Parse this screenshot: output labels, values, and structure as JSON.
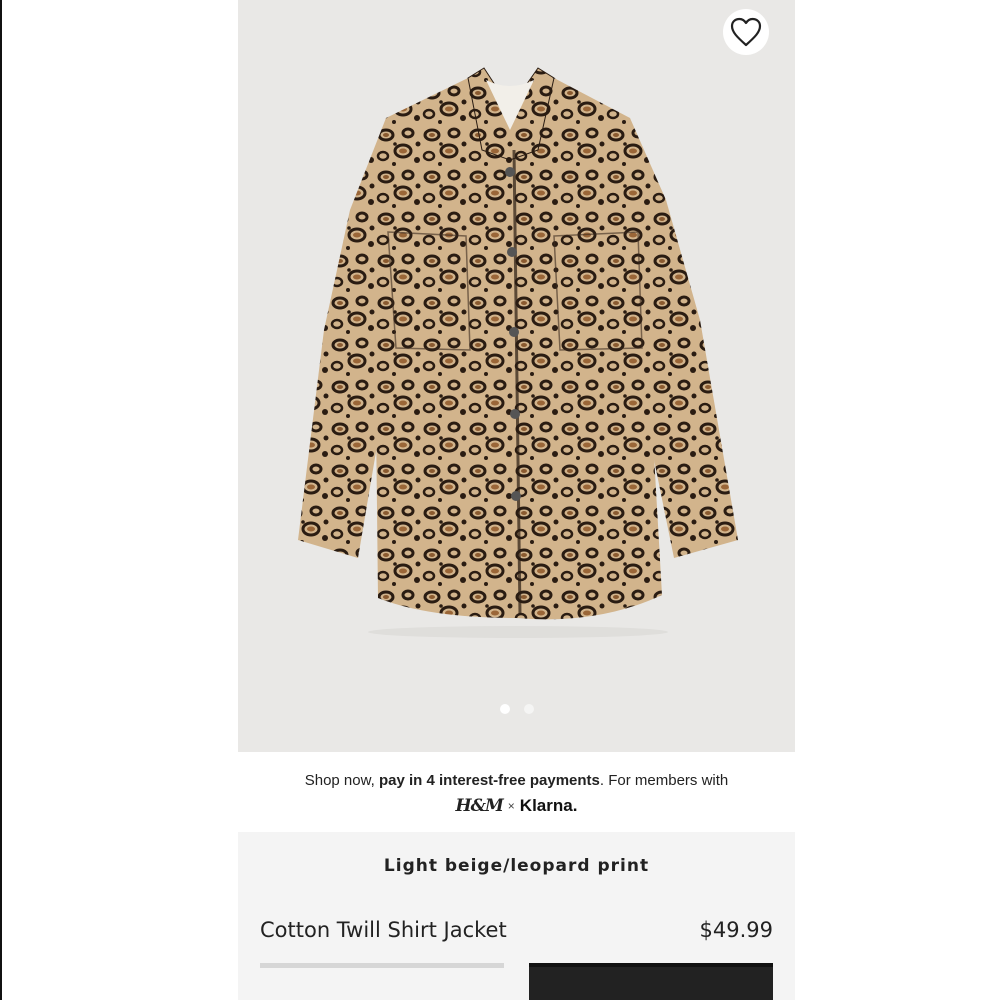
{
  "product_image": {
    "alt": "Light beige/leopard print Cotton Twill Shirt Jacket",
    "background_color": "#e9e8e6",
    "carousel_total": 2,
    "carousel_active": 1
  },
  "favorite": {
    "icon": "heart-outline-icon"
  },
  "payment_banner": {
    "text_prefix": "Shop now, ",
    "text_bold": "pay in 4 interest-free payments",
    "text_suffix": ". For members with",
    "hm_logo": "H&M",
    "separator": "×",
    "klarna_logo": "Klarna."
  },
  "product": {
    "color": "Light beige/leopard print",
    "name": "Cotton Twill Shirt Jacket",
    "price": "$49.99"
  },
  "colors": {
    "leopard_base": "#c9a77a",
    "leopard_spot": "#2a1c12",
    "leopard_core": "#8a5a30",
    "button_dark": "#222222",
    "panel_bg": "#f4f4f4"
  }
}
